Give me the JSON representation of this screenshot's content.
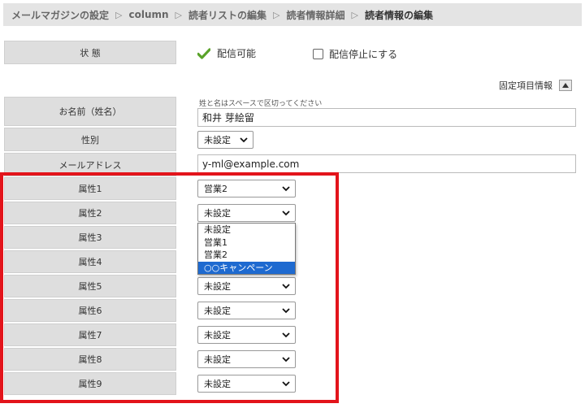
{
  "breadcrumb": [
    "メールマガジンの設定",
    "column",
    "読者リストの編集",
    "読者情報詳細",
    "読者情報の編集"
  ],
  "status": {
    "label": "状 態",
    "value": "配信可能",
    "stop_option": "配信停止にする",
    "stop_checked": false
  },
  "fixed_fields": {
    "title": "固定項目情報",
    "toggle_icon": "triangle-up-icon"
  },
  "name": {
    "label": "お名前（姓名）",
    "hint": "姓と名はスペースで区切ってください",
    "value": "和井 芽絵留"
  },
  "gender": {
    "label": "性別",
    "value": "未設定"
  },
  "email": {
    "label": "メールアドレス",
    "value": "y-ml@example.com"
  },
  "attributes": [
    {
      "label": "属性1",
      "value": "営業2"
    },
    {
      "label": "属性2",
      "value": "未設定"
    },
    {
      "label": "属性3",
      "value": ""
    },
    {
      "label": "属性4",
      "value": ""
    },
    {
      "label": "属性5",
      "value": "未設定"
    },
    {
      "label": "属性6",
      "value": "未設定"
    },
    {
      "label": "属性7",
      "value": "未設定"
    },
    {
      "label": "属性8",
      "value": "未設定"
    },
    {
      "label": "属性9",
      "value": "未設定"
    }
  ],
  "dropdown": {
    "options": [
      "未設定",
      "営業1",
      "営業2",
      "○○キャンペーン"
    ],
    "highlighted_index": 3
  },
  "colors": {
    "highlight_border": "#e3141b",
    "check_icon": "#5aa32a",
    "dropdown_selected": "#1e6ad0"
  }
}
